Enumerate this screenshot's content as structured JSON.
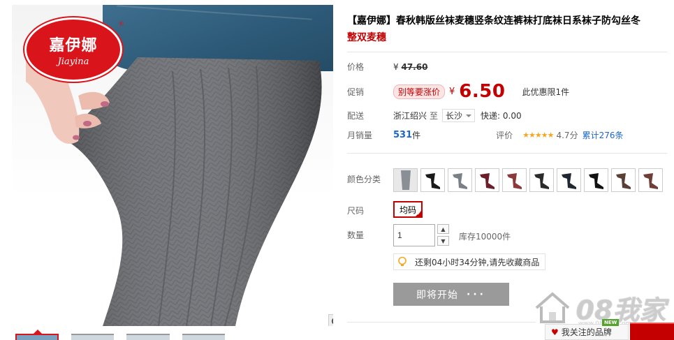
{
  "brand_logo": {
    "cn": "嘉伊娜",
    "en": "Jiayina",
    "reg": "®"
  },
  "product": {
    "title": "【嘉伊娜】春秋韩版丝袜麦穗竖条纹连裤袜打底袜日系袜子防勾丝冬",
    "subtitle": "整双麦穗"
  },
  "price": {
    "label": "价格",
    "currency": "¥",
    "original": "47.60"
  },
  "promo": {
    "label": "促销",
    "tag": "别等要涨价",
    "currency": "¥",
    "value": "6.50",
    "limit": "此优惠限1件"
  },
  "delivery": {
    "label": "配送",
    "from": "浙江绍兴",
    "to_word": "至",
    "city": "长沙",
    "express": "快递: 0.00"
  },
  "sales": {
    "label": "月销量",
    "count": "531",
    "unit": "件",
    "rating_label": "评价",
    "stars": "★★★★★",
    "score": "4.7分",
    "total_prefix": "累计",
    "total": "276",
    "total_unit": "条"
  },
  "color": {
    "label": "颜色分类",
    "swatches": [
      "#8a8f96",
      "#1a1a1a",
      "#7b7f87",
      "#6b1e2a",
      "#8a3a3a",
      "#2b2b2b",
      "#1f2733",
      "#121212",
      "#5a3f34",
      "#6e3f36"
    ]
  },
  "size": {
    "label": "尺码",
    "value": "均码"
  },
  "quantity": {
    "label": "数量",
    "value": "1",
    "up": "▲",
    "down": "▼",
    "stock": "库存10000件"
  },
  "notice": {
    "text": "还剩04小时34分钟,请先收藏商品"
  },
  "start_button": {
    "label": "即将开始",
    "dots": "···"
  },
  "follow_brand": {
    "heart": "♥",
    "label": "我关注的品牌",
    "badge": "NEW"
  },
  "watermark": {
    "text": "08我家",
    "url": "www.08won.com"
  },
  "colors": {
    "accent": "#c40000",
    "link": "#1b66c9"
  }
}
